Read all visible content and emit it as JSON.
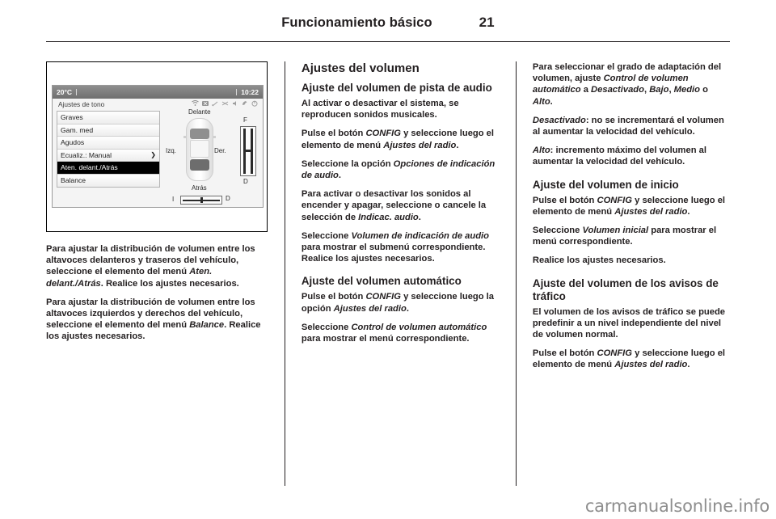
{
  "header": {
    "title": "Funcionamiento básico",
    "page_number": "21"
  },
  "figure": {
    "status": {
      "temperature": "20°C",
      "clock": "10:22"
    },
    "screen_title": "Ajustes de tono",
    "status_icons": [
      "wifi-icon",
      "bluetooth-icon",
      "signal-icon",
      "shuffle-icon",
      "mute-icon",
      "phone-icon",
      "power-icon"
    ],
    "menu_items": [
      {
        "label": "Graves",
        "selected": false,
        "chevron": ""
      },
      {
        "label": "Gam. med",
        "selected": false,
        "chevron": ""
      },
      {
        "label": "Agudos",
        "selected": false,
        "chevron": ""
      },
      {
        "label": "Ecualiz.: Manual",
        "selected": false,
        "chevron": "❯"
      },
      {
        "label": "Aten. delant./Atrás",
        "selected": true,
        "chevron": ""
      },
      {
        "label": "Balance",
        "selected": false,
        "chevron": ""
      }
    ],
    "car_labels": {
      "front": "Delante",
      "left": "Izq.",
      "right": "Der.",
      "rear": "Atrás",
      "slider_v_top": "F",
      "slider_v_bottom": "D",
      "slider_h_left": "I",
      "slider_h_right": "D"
    }
  },
  "column_left": {
    "paragraphs": [
      {
        "parts": [
          {
            "text": "Para ajustar la distribución de volumen entre los altavoces delanteros y traseros del vehículo, seleccione el elemento del menú ",
            "italic": false
          },
          {
            "text": "Aten. delant./Atrás",
            "italic": true
          },
          {
            "text": ". Realice los ajustes necesarios.",
            "italic": false
          }
        ]
      },
      {
        "parts": [
          {
            "text": "Para ajustar la distribución de volumen entre los altavoces izquierdos y derechos del vehículo, seleccione el elemento del menú ",
            "italic": false
          },
          {
            "text": "Balance",
            "italic": true
          },
          {
            "text": ". Realice los ajustes necesarios.",
            "italic": false
          }
        ]
      }
    ]
  },
  "column_middle": {
    "section_title": "Ajustes del volumen",
    "sub1_title": "Ajuste del volumen de pista de audio",
    "sub1_paragraphs": [
      {
        "parts": [
          {
            "text": "Al activar o desactivar el sistema, se reproducen sonidos musicales.",
            "italic": false
          }
        ]
      },
      {
        "parts": [
          {
            "text": "Pulse el botón ",
            "italic": false
          },
          {
            "text": "CONFIG",
            "italic": true
          },
          {
            "text": " y seleccione luego el elemento de menú ",
            "italic": false
          },
          {
            "text": "Ajustes del radio",
            "italic": true
          },
          {
            "text": ".",
            "italic": false
          }
        ]
      },
      {
        "parts": [
          {
            "text": "Seleccione la opción ",
            "italic": false
          },
          {
            "text": "Opciones de indicación de audio",
            "italic": true
          },
          {
            "text": ".",
            "italic": false
          }
        ]
      },
      {
        "parts": [
          {
            "text": "Para activar o desactivar los sonidos al encender y apagar, seleccione o cancele la selección de ",
            "italic": false
          },
          {
            "text": "Indicac. audio",
            "italic": true
          },
          {
            "text": ".",
            "italic": false
          }
        ]
      },
      {
        "parts": [
          {
            "text": "Seleccione ",
            "italic": false
          },
          {
            "text": "Volumen de indicación de audio",
            "italic": true
          },
          {
            "text": " para mostrar el submenú correspondiente. Realice los ajustes necesarios.",
            "italic": false
          }
        ]
      }
    ],
    "sub2_title": "Ajuste del volumen automático",
    "sub2_paragraphs": [
      {
        "parts": [
          {
            "text": "Pulse el botón ",
            "italic": false
          },
          {
            "text": "CONFIG",
            "italic": true
          },
          {
            "text": " y seleccione luego la opción ",
            "italic": false
          },
          {
            "text": "Ajustes del radio",
            "italic": true
          },
          {
            "text": ".",
            "italic": false
          }
        ]
      },
      {
        "parts": [
          {
            "text": "Seleccione ",
            "italic": false
          },
          {
            "text": "Control de volumen automático",
            "italic": true
          },
          {
            "text": " para mostrar el menú correspondiente.",
            "italic": false
          }
        ]
      }
    ]
  },
  "column_right": {
    "intro_paragraphs": [
      {
        "parts": [
          {
            "text": "Para seleccionar el grado de adaptación del volumen, ajuste ",
            "italic": false
          },
          {
            "text": "Control de volumen automático",
            "italic": true
          },
          {
            "text": " a ",
            "italic": false
          },
          {
            "text": "Desactivado",
            "italic": true
          },
          {
            "text": ", ",
            "italic": false
          },
          {
            "text": "Bajo",
            "italic": true
          },
          {
            "text": ", ",
            "italic": false
          },
          {
            "text": "Medio",
            "italic": true
          },
          {
            "text": " o ",
            "italic": false
          },
          {
            "text": "Alto",
            "italic": true
          },
          {
            "text": ".",
            "italic": false
          }
        ]
      },
      {
        "parts": [
          {
            "text": "Desactivado",
            "italic": true
          },
          {
            "text": ": no se incrementará el volumen al aumentar la velocidad del vehículo.",
            "italic": false
          }
        ]
      },
      {
        "parts": [
          {
            "text": "Alto",
            "italic": true
          },
          {
            "text": ": incremento máximo del volumen al aumentar la velocidad del vehículo.",
            "italic": false
          }
        ]
      }
    ],
    "sub1_title": "Ajuste del volumen de inicio",
    "sub1_paragraphs": [
      {
        "parts": [
          {
            "text": "Pulse el botón ",
            "italic": false
          },
          {
            "text": "CONFIG",
            "italic": true
          },
          {
            "text": " y seleccione luego el elemento de menú ",
            "italic": false
          },
          {
            "text": "Ajustes del radio",
            "italic": true
          },
          {
            "text": ".",
            "italic": false
          }
        ]
      },
      {
        "parts": [
          {
            "text": "Seleccione ",
            "italic": false
          },
          {
            "text": "Volumen inicial",
            "italic": true
          },
          {
            "text": " para mostrar el menú correspondiente.",
            "italic": false
          }
        ]
      },
      {
        "parts": [
          {
            "text": "Realice los ajustes necesarios.",
            "italic": false
          }
        ]
      }
    ],
    "sub2_title": "Ajuste del volumen de los avisos de tráfico",
    "sub2_paragraphs": [
      {
        "parts": [
          {
            "text": "El volumen de los avisos de tráfico se puede predefinir a un nivel independiente del nivel de volumen normal.",
            "italic": false
          }
        ]
      },
      {
        "parts": [
          {
            "text": "Pulse el botón ",
            "italic": false
          },
          {
            "text": "CONFIG",
            "italic": true
          },
          {
            "text": " y seleccione luego el elemento de menú ",
            "italic": false
          },
          {
            "text": "Ajustes del radio",
            "italic": true
          },
          {
            "text": ".",
            "italic": false
          }
        ]
      }
    ]
  },
  "footer": {
    "watermark": "carmanualsonline.info"
  }
}
